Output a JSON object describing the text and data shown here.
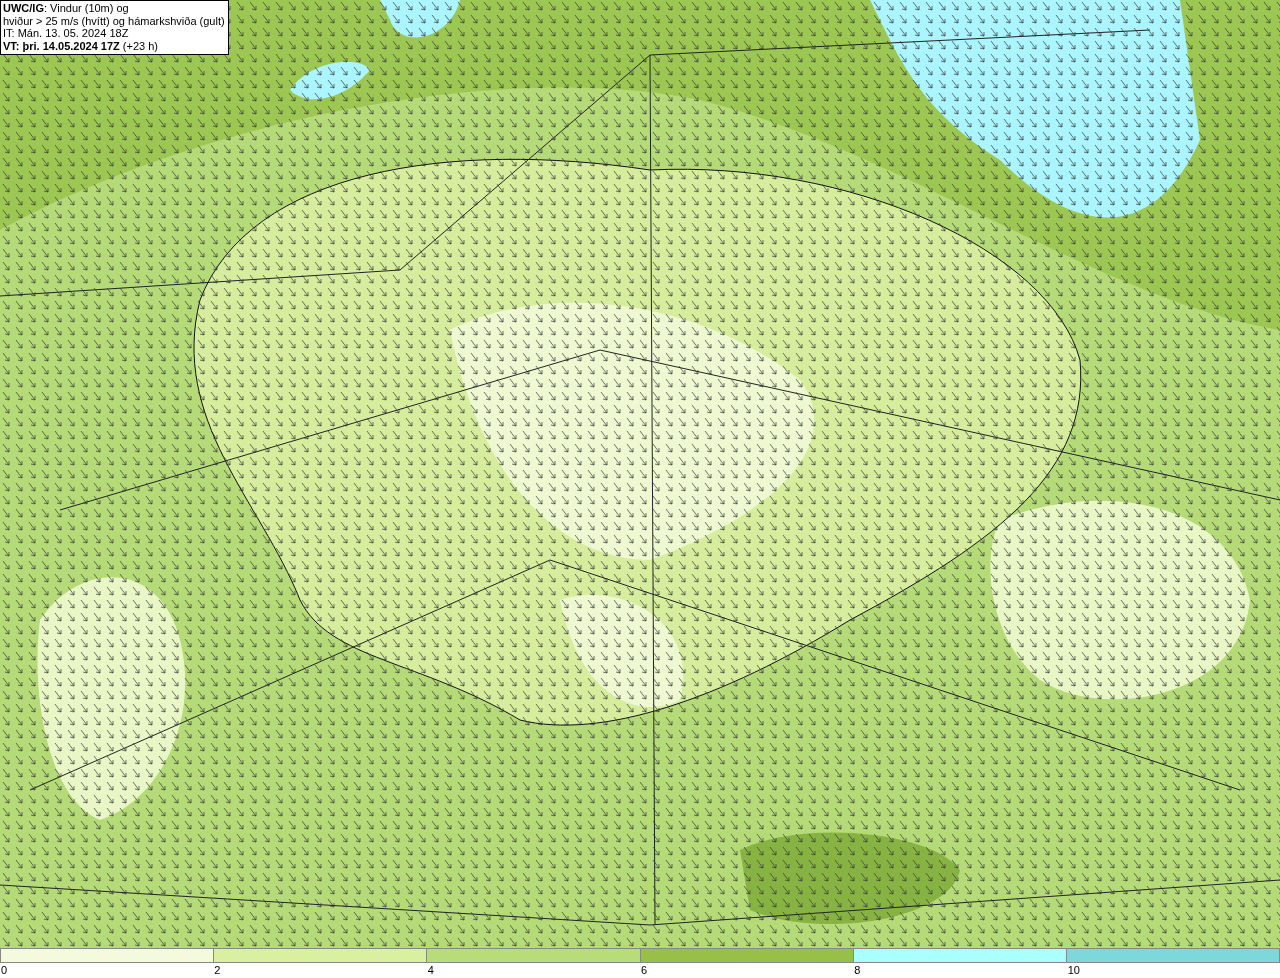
{
  "info_box": {
    "lines": [
      "**UWC/IG**: Vindur (10m) og",
      "hviður > 25 m/s (hvítt) og hámarkshviða (gult)",
      "IT: Mán. 13. 05. 2024 18Z",
      "**VT: þri. 14.05.2024 17Z** (+23 h)"
    ]
  },
  "color_scale": {
    "segments": [
      {
        "color": "#f4fbdc"
      },
      {
        "color": "#d9f0a0"
      },
      {
        "color": "#b8dd78"
      },
      {
        "color": "#98c048"
      },
      {
        "color": "#aaffff"
      },
      {
        "color": "#7dd8dc"
      }
    ],
    "ticks": [
      "0",
      "2",
      "4",
      "6",
      "8",
      "10"
    ]
  }
}
